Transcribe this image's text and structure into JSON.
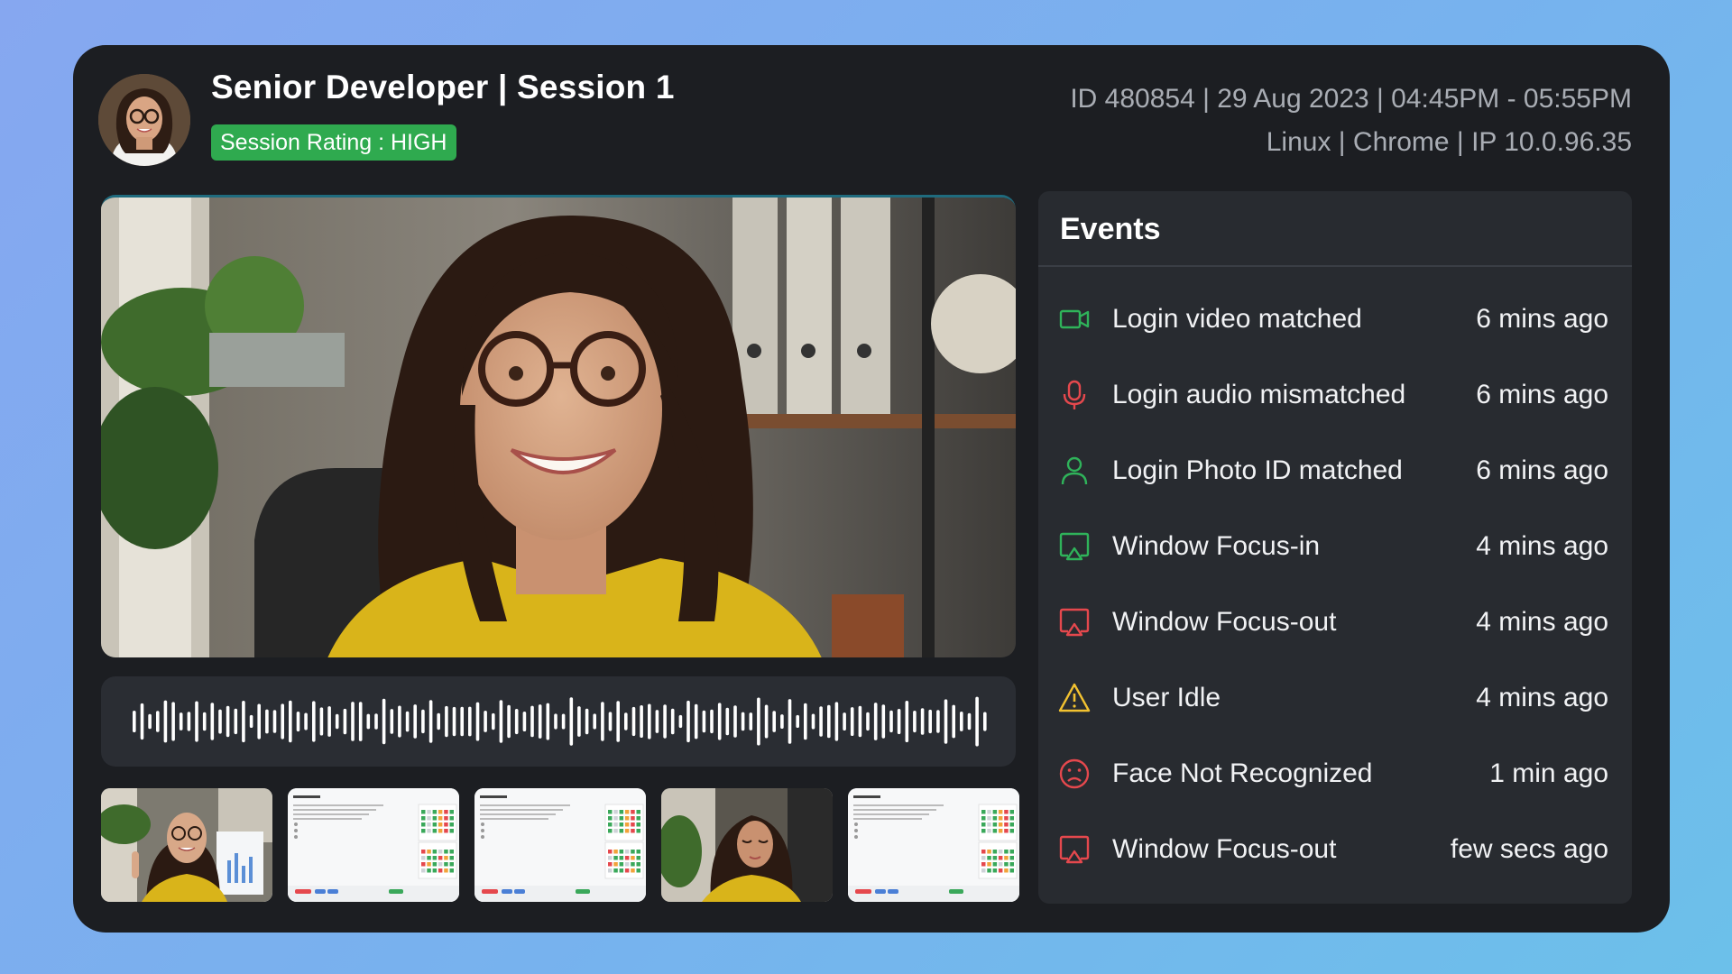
{
  "header": {
    "title": "Senior Developer | Session 1",
    "rating_badge": "Session Rating : HIGH",
    "meta_line1": "ID 480854 | 29 Aug 2023 | 04:45PM - 05:55PM",
    "meta_line2": "Linux | Chrome | IP 10.0.96.35"
  },
  "events": {
    "title": "Events",
    "items": [
      {
        "icon": "video-camera-icon",
        "label": "Login video matched",
        "time": "6 mins ago",
        "color": "#2fb35a"
      },
      {
        "icon": "microphone-icon",
        "label": "Login audio mismatched",
        "time": "6 mins ago",
        "color": "#e5484d"
      },
      {
        "icon": "user-icon",
        "label": "Login Photo ID matched",
        "time": "6 mins ago",
        "color": "#2fb35a"
      },
      {
        "icon": "screen-cast-icon",
        "label": "Window Focus-in",
        "time": "4 mins ago",
        "color": "#2fb35a"
      },
      {
        "icon": "screen-cast-icon",
        "label": "Window Focus-out",
        "time": "4 mins ago",
        "color": "#e5484d"
      },
      {
        "icon": "warning-triangle-icon",
        "label": "User Idle",
        "time": "4 mins ago",
        "color": "#f2c230"
      },
      {
        "icon": "sad-face-icon",
        "label": "Face Not Recognized",
        "time": "1 min ago",
        "color": "#e5484d"
      },
      {
        "icon": "screen-cast-icon",
        "label": "Window Focus-out",
        "time": "few secs ago",
        "color": "#e5484d"
      }
    ]
  },
  "colors": {
    "card_bg": "#1c1e22",
    "panel_bg": "#282b30",
    "badge_green": "#2faa4f",
    "meta_text": "#a9adb4"
  }
}
